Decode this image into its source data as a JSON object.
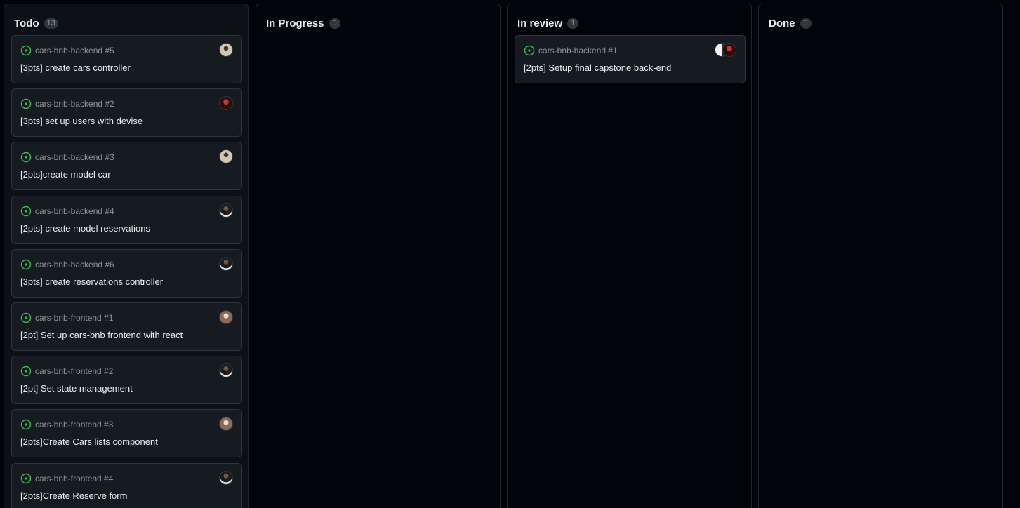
{
  "columns": [
    {
      "title": "Todo",
      "count": "13",
      "cards": [
        {
          "repo": "cars-bnb-backend #5",
          "title": "[3pts] create cars controller",
          "avatars": [
            "user-avatar"
          ]
        },
        {
          "repo": "cars-bnb-backend #2",
          "title": "[3pts] set up users with devise",
          "avatars": [
            "user-avatar"
          ]
        },
        {
          "repo": "cars-bnb-backend #3",
          "title": "[2pts]create model car",
          "avatars": [
            "user-avatar"
          ]
        },
        {
          "repo": "cars-bnb-backend #4",
          "title": "[2pts] create model reservations",
          "avatars": [
            "user-avatar"
          ]
        },
        {
          "repo": "cars-bnb-backend #6",
          "title": "[3pts] create reservations controller",
          "avatars": [
            "user-avatar"
          ]
        },
        {
          "repo": "cars-bnb-frontend #1",
          "title": "[2pt] Set up cars-bnb frontend with react",
          "avatars": [
            "user-avatar"
          ]
        },
        {
          "repo": "cars-bnb-frontend #2",
          "title": "[2pt] Set state management",
          "avatars": [
            "user-avatar"
          ]
        },
        {
          "repo": "cars-bnb-frontend #3",
          "title": "[2pts]Create Cars lists component",
          "avatars": [
            "user-avatar"
          ]
        },
        {
          "repo": "cars-bnb-frontend #4",
          "title": "[2pts]Create Reserve form",
          "avatars": [
            "user-avatar"
          ]
        }
      ]
    },
    {
      "title": "In Progress",
      "count": "0",
      "cards": []
    },
    {
      "title": "In review",
      "count": "1",
      "cards": [
        {
          "repo": "cars-bnb-backend #1",
          "title": "[2pts] Setup final capstone back-end",
          "avatars": [
            "user-avatar",
            "user-avatar"
          ]
        }
      ]
    },
    {
      "title": "Done",
      "count": "0",
      "cards": []
    }
  ],
  "colors": {
    "background": "#010409",
    "card": "#161b22",
    "border": "#30363d",
    "open_issue": "#3fb950",
    "muted_text": "#8b949e"
  }
}
